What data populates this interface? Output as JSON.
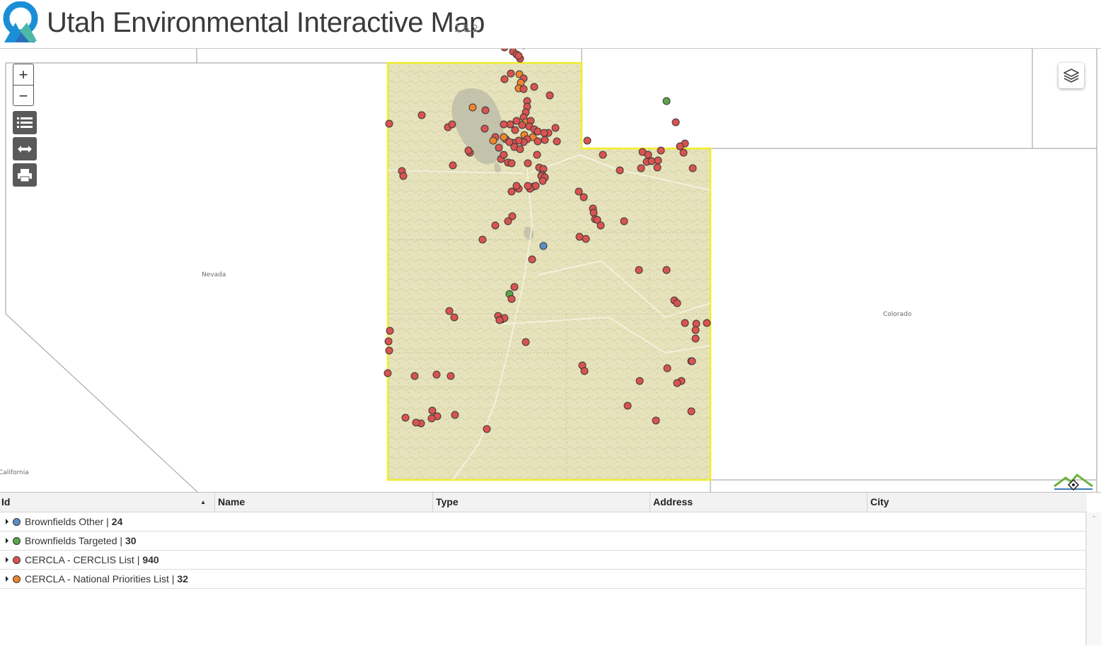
{
  "app": {
    "title": "Utah Environmental Interactive Map",
    "version": "1.5.2"
  },
  "map": {
    "labels": {
      "nevada": "Nevada",
      "colorado": "Colorado",
      "california": "California"
    },
    "controls": {
      "zoom_in": "+",
      "zoom_out": "−"
    },
    "colors": {
      "boundary": "#f2ee2a",
      "terrain": "#e6e3bc",
      "brownfields_other": "#5b8fc7",
      "brownfields_targeted": "#5aa64a",
      "cercla_cerclis": "#d9534f",
      "cercla_npl": "#f0852d"
    }
  },
  "table": {
    "columns": [
      "Id",
      "Name",
      "Type",
      "Address",
      "City"
    ],
    "sort_column": "Id",
    "groups": [
      {
        "label": "Brownfields Other | ",
        "count": "24",
        "color": "#5b8fc7"
      },
      {
        "label": "Brownfields Targeted | ",
        "count": "30",
        "color": "#5aa64a"
      },
      {
        "label": "CERCLA - CERCLIS List | ",
        "count": "940",
        "color": "#d9534f"
      },
      {
        "label": "CERCLA - National Priorities List | ",
        "count": "32",
        "color": "#f0852d"
      }
    ]
  }
}
